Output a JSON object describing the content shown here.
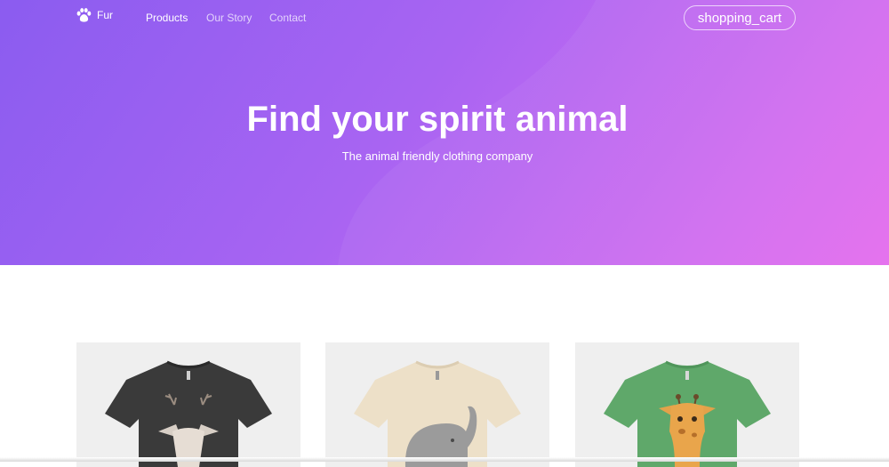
{
  "brand": {
    "name": "Fur",
    "icon": "paw-icon"
  },
  "nav": {
    "links": [
      {
        "label": "Products",
        "active": true
      },
      {
        "label": "Our Story",
        "active": false
      },
      {
        "label": "Contact",
        "active": false
      }
    ],
    "cart_label": "shopping_cart"
  },
  "hero": {
    "title": "Find your spirit animal",
    "subtitle": "The animal friendly clothing company",
    "gradient_colors": [
      "#8b5cf0",
      "#e46cee"
    ]
  },
  "products": [
    {
      "shirt_color": "#3a3a3a",
      "graphic": "deer"
    },
    {
      "shirt_color": "#ede0c8",
      "graphic": "elephant"
    },
    {
      "shirt_color": "#5fa86a",
      "graphic": "giraffe"
    }
  ]
}
